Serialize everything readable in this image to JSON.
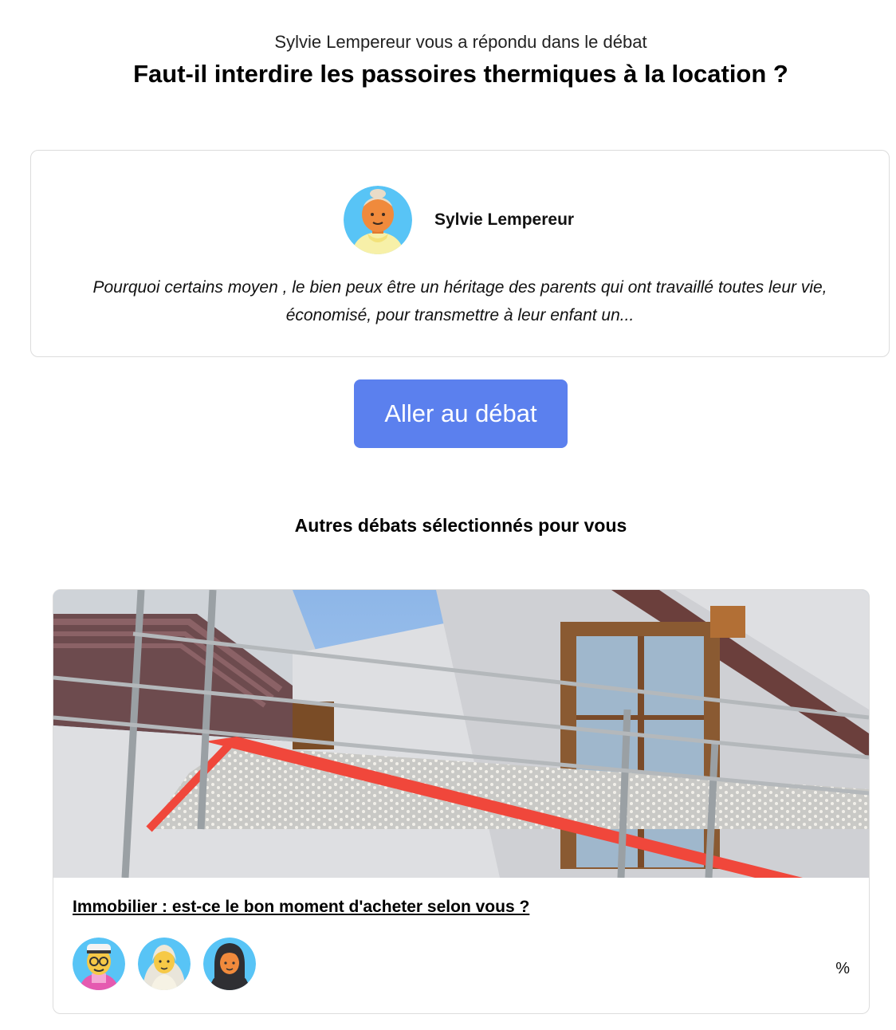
{
  "intro": "Sylvie Lempereur vous a répondu dans le débat",
  "debate_title": "Faut-il interdire les passoires thermiques à la location ?",
  "reply": {
    "author": "Sylvie Lempereur",
    "avatar_icon": "person-avatar-icon",
    "text": "Pourquoi certains moyen , le bien peux être un héritage des parents qui ont travaillé toutes leur vie, économisé, pour transmettre à leur enfant un..."
  },
  "go_button": "Aller au débat",
  "other_heading": "Autres débats sélectionnés pour vous",
  "other_debate": {
    "title": "Immobilier : est-ce le bon moment d'acheter selon vous ?",
    "participant_icons": [
      "participant-avatar-icon",
      "participant-avatar-icon",
      "participant-avatar-icon"
    ],
    "percent": "%"
  },
  "colors": {
    "button": "#5b80ee",
    "avatar_bg": "#58c4f6",
    "skin": "#f08a3c",
    "scaffold_red": "#f0473b"
  }
}
